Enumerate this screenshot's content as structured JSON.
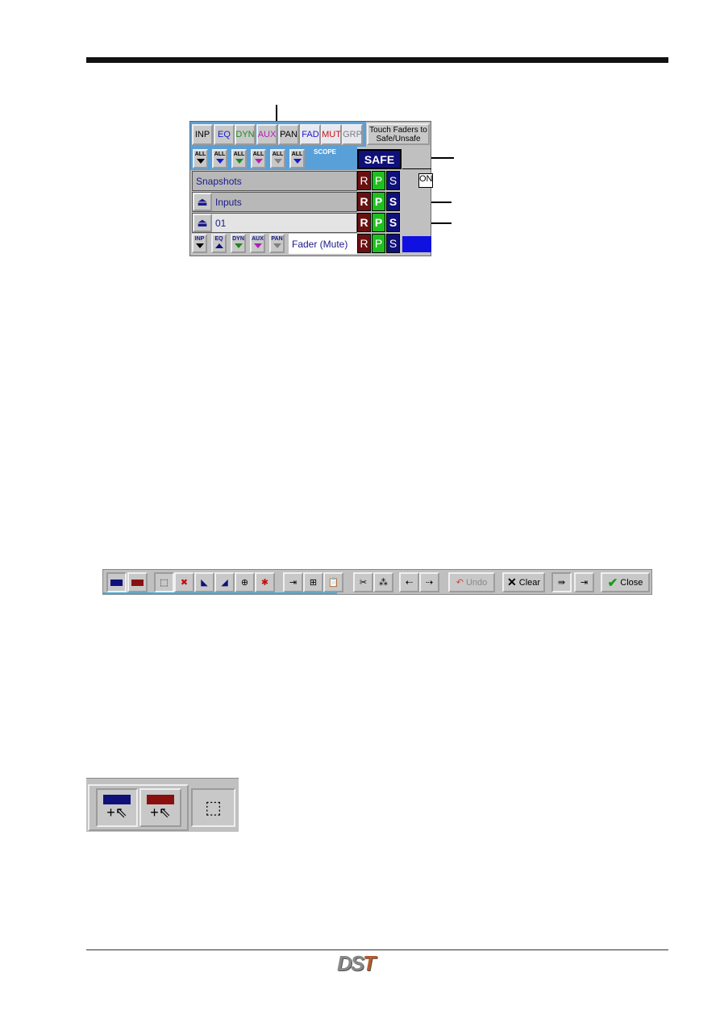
{
  "scope_panel": {
    "filter_tabs": [
      {
        "label": "INP",
        "color": "#000000"
      },
      {
        "label": "EQ",
        "color": "#1a1acc"
      },
      {
        "label": "DYN",
        "color": "#1a8a1a"
      },
      {
        "label": "AUX",
        "color": "#b020b0"
      },
      {
        "label": "PAN",
        "color": "#000000"
      },
      {
        "label": "FAD",
        "color": "#1a1acc"
      },
      {
        "label": "MUT",
        "color": "#cc1010"
      },
      {
        "label": "GRP",
        "color": "#808080"
      }
    ],
    "touch_faders_label": "Touch Faders to Safe/Unsafe",
    "all_buttons": [
      {
        "label": "ALL",
        "color": "#000000"
      },
      {
        "label": "ALL",
        "color": "#1a1acc"
      },
      {
        "label": "ALL",
        "color": "#1a8a1a"
      },
      {
        "label": "ALL",
        "color": "#b020b0"
      },
      {
        "label": "ALL",
        "color": "#808080"
      },
      {
        "label": "ALL",
        "color": "#1a1acc"
      }
    ],
    "scope_label": "SCOPE",
    "safe_label": "SAFE",
    "rows": [
      {
        "label": "Snapshots"
      },
      {
        "label": "Inputs"
      },
      {
        "label": "01"
      },
      {
        "label": "Fader (Mute)"
      }
    ],
    "rps": [
      "R",
      "P",
      "S"
    ],
    "bottom_buttons": [
      {
        "label": "INP",
        "color": "#000000"
      },
      {
        "label": "EQ",
        "color": "#10107a"
      },
      {
        "label": "DYN",
        "color": "#1a8a1a"
      },
      {
        "label": "AUX",
        "color": "#b020b0"
      },
      {
        "label": "PAN",
        "color": "#808080"
      }
    ],
    "on_label": "ON"
  },
  "toolbar": {
    "undo_label": "Undo",
    "clear_label": "Clear",
    "close_label": "Close"
  },
  "logo_text": "DST"
}
